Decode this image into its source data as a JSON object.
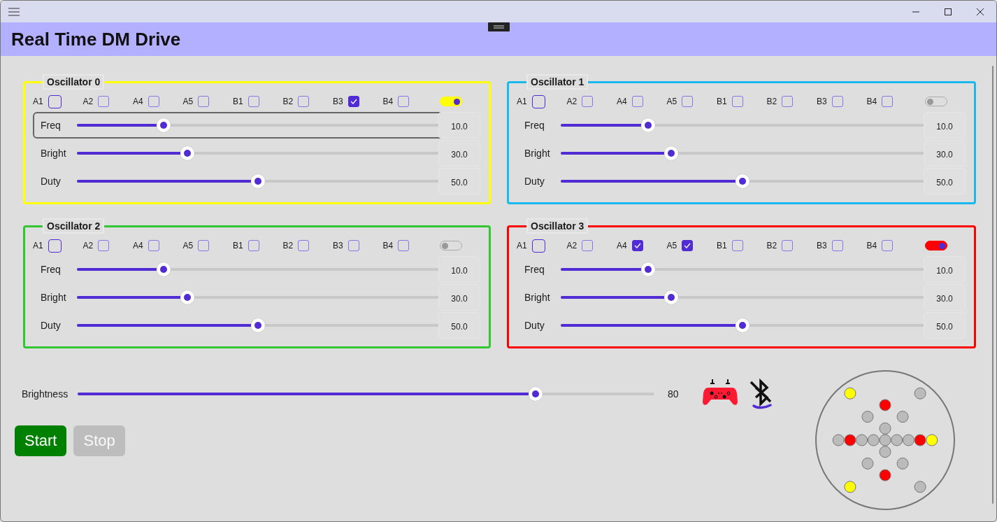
{
  "window": {
    "title": "Real Time DM Drive"
  },
  "oscillators": [
    {
      "name": "Oscillator 0",
      "color": "#ffff00",
      "on": true,
      "channels": [
        {
          "label": "A1",
          "checked": false,
          "focused": true
        },
        {
          "label": "A2",
          "checked": false,
          "focused": false
        },
        {
          "label": "A4",
          "checked": false,
          "focused": false
        },
        {
          "label": "A5",
          "checked": false,
          "focused": false
        },
        {
          "label": "B1",
          "checked": false,
          "focused": false
        },
        {
          "label": "B2",
          "checked": false,
          "focused": false
        },
        {
          "label": "B3",
          "checked": true,
          "focused": false
        },
        {
          "label": "B4",
          "checked": false,
          "focused": false
        }
      ],
      "sliders": [
        {
          "label": "Freq",
          "level": 0.24,
          "value": "10.0",
          "focused": true
        },
        {
          "label": "Bright",
          "level": 0.305,
          "value": "30.0",
          "focused": false
        },
        {
          "label": "Duty",
          "level": 0.5,
          "value": "50.0",
          "focused": false
        }
      ]
    },
    {
      "name": "Oscillator 1",
      "color": "#1ab8ec",
      "on": false,
      "channels": [
        {
          "label": "A1",
          "checked": false,
          "focused": true
        },
        {
          "label": "A2",
          "checked": false,
          "focused": false
        },
        {
          "label": "A4",
          "checked": false,
          "focused": false
        },
        {
          "label": "A5",
          "checked": false,
          "focused": false
        },
        {
          "label": "B1",
          "checked": false,
          "focused": false
        },
        {
          "label": "B2",
          "checked": false,
          "focused": false
        },
        {
          "label": "B3",
          "checked": false,
          "focused": false
        },
        {
          "label": "B4",
          "checked": false,
          "focused": false
        }
      ],
      "sliders": [
        {
          "label": "Freq",
          "level": 0.24,
          "value": "10.0",
          "focused": false
        },
        {
          "label": "Bright",
          "level": 0.305,
          "value": "30.0",
          "focused": false
        },
        {
          "label": "Duty",
          "level": 0.5,
          "value": "50.0",
          "focused": false
        }
      ]
    },
    {
      "name": "Oscillator 2",
      "color": "#33c633",
      "on": false,
      "channels": [
        {
          "label": "A1",
          "checked": false,
          "focused": true
        },
        {
          "label": "A2",
          "checked": false,
          "focused": false
        },
        {
          "label": "A4",
          "checked": false,
          "focused": false
        },
        {
          "label": "A5",
          "checked": false,
          "focused": false
        },
        {
          "label": "B1",
          "checked": false,
          "focused": false
        },
        {
          "label": "B2",
          "checked": false,
          "focused": false
        },
        {
          "label": "B3",
          "checked": false,
          "focused": false
        },
        {
          "label": "B4",
          "checked": false,
          "focused": false
        }
      ],
      "sliders": [
        {
          "label": "Freq",
          "level": 0.24,
          "value": "10.0",
          "focused": false
        },
        {
          "label": "Bright",
          "level": 0.305,
          "value": "30.0",
          "focused": false
        },
        {
          "label": "Duty",
          "level": 0.5,
          "value": "50.0",
          "focused": false
        }
      ]
    },
    {
      "name": "Oscillator 3",
      "color": "#ff0000",
      "on": true,
      "channels": [
        {
          "label": "A1",
          "checked": false,
          "focused": true
        },
        {
          "label": "A2",
          "checked": false,
          "focused": false
        },
        {
          "label": "A4",
          "checked": true,
          "focused": false
        },
        {
          "label": "A5",
          "checked": true,
          "focused": false
        },
        {
          "label": "B1",
          "checked": false,
          "focused": false
        },
        {
          "label": "B2",
          "checked": false,
          "focused": false
        },
        {
          "label": "B3",
          "checked": false,
          "focused": false
        },
        {
          "label": "B4",
          "checked": false,
          "focused": false
        }
      ],
      "sliders": [
        {
          "label": "Freq",
          "level": 0.24,
          "value": "10.0",
          "focused": false
        },
        {
          "label": "Bright",
          "level": 0.305,
          "value": "30.0",
          "focused": false
        },
        {
          "label": "Duty",
          "level": 0.5,
          "value": "50.0",
          "focused": false
        }
      ]
    }
  ],
  "brightness": {
    "label": "Brightness",
    "level": 0.795,
    "value": "80"
  },
  "buttons": [
    {
      "label": "Start",
      "disabled": false
    },
    {
      "label": "Stop",
      "disabled": true
    }
  ],
  "pins": [
    {
      "color": "#bbbbbb"
    },
    {
      "color": "#ff0000"
    },
    {
      "color": "#bbbbbb"
    },
    {
      "color": "#bbbbbb"
    },
    {
      "color": "#bbbbbb"
    },
    {
      "color": "#bbbbbb"
    },
    {
      "color": "#bbbbbb"
    },
    {
      "color": "#ff0000"
    },
    {
      "color": "#ffff00"
    },
    {
      "color": "#ff0000"
    },
    {
      "color": "#bbbbbb"
    },
    {
      "color": "#bbbbbb"
    },
    {
      "color": "#ff0000"
    },
    {
      "color": "#bbbbbb"
    },
    {
      "color": "#bbbbbb"
    },
    {
      "color": "#bbbbbb"
    },
    {
      "color": "#bbbbbb"
    },
    {
      "color": "#ffff00"
    },
    {
      "color": "#bbbbbb"
    },
    {
      "color": "#ffff00"
    },
    {
      "color": "#bbbbbb"
    }
  ]
}
